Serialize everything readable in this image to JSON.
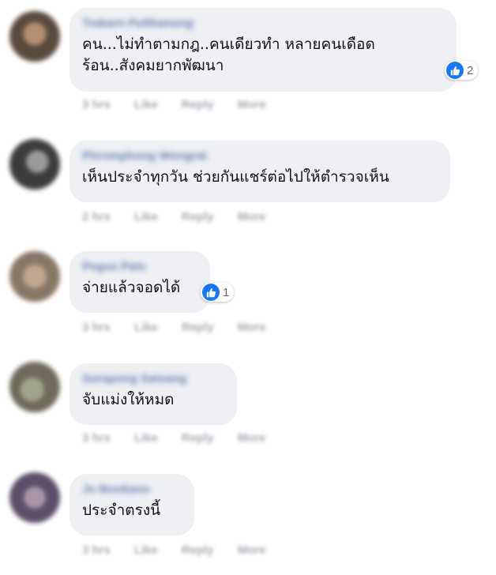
{
  "comments": [
    {
      "author": "Trakarn Pulthanung",
      "text_lines": [
        "คน...ไม่ทำตามกฎ..คนเดียวทำ หลายคนเดือด",
        "ร้อน..สังคมยากพัฒนา"
      ],
      "reactions": "2",
      "time": "3 hrs",
      "avatar_color": "#5a4a3c"
    },
    {
      "author": "Phromphong Wongrat",
      "text_lines": [
        "เห็นประจำทุกวัน ช่วยกันแชร์ต่อไปให้ตำรวจเห็น"
      ],
      "reactions": "",
      "time": "2 hrs",
      "avatar_color": "#3c3c3c"
    },
    {
      "author": "Pegus Pats",
      "text_lines": [
        "จ่ายแล้วจอดได้"
      ],
      "reactions": "1",
      "time": "3 hrs",
      "avatar_color": "#8a7866"
    },
    {
      "author": "Surapong Satsang",
      "text_lines": [
        "จับแม่งให้หมด"
      ],
      "reactions": "",
      "time": "3 hrs",
      "avatar_color": "#6f6a5a"
    },
    {
      "author": "Jo Bookano",
      "text_lines": [
        "ประจำตรงนี้"
      ],
      "reactions": "",
      "time": "3 hrs",
      "avatar_color": "#5c4f6a"
    }
  ],
  "actions": {
    "like": "Like",
    "reply": "Reply",
    "more": "More"
  },
  "colors": {
    "bubble": "#eef0f3",
    "like_blue": "#1877f2",
    "author_link": "#385898"
  }
}
